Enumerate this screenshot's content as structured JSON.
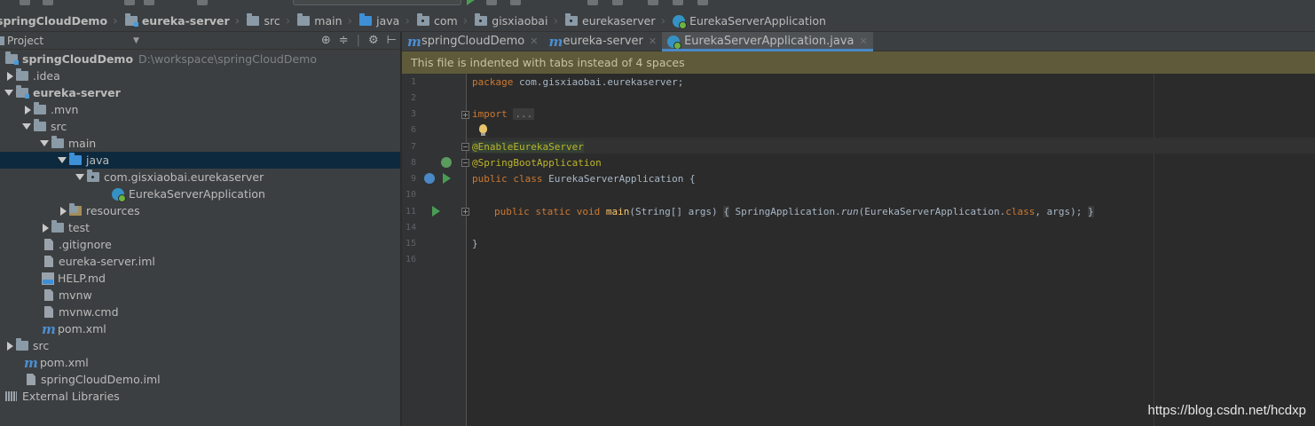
{
  "breadcrumbs": [
    {
      "label": "springCloudDemo",
      "icon": "module-folder-icon"
    },
    {
      "label": "eureka-server",
      "icon": "module-folder-icon"
    },
    {
      "label": "src",
      "icon": "folder-icon"
    },
    {
      "label": "main",
      "icon": "folder-icon"
    },
    {
      "label": "java",
      "icon": "source-folder-icon"
    },
    {
      "label": "com",
      "icon": "package-icon"
    },
    {
      "label": "gisxiaobai",
      "icon": "package-icon"
    },
    {
      "label": "eurekaserver",
      "icon": "package-icon"
    },
    {
      "label": "EurekaServerApplication",
      "icon": "spring-boot-class-icon"
    }
  ],
  "project_panel": {
    "title": "Project",
    "tree": [
      {
        "label": "springCloudDemo",
        "extra": "D:\\workspace\\springCloudDemo",
        "icon": "module-folder-icon",
        "expanded": true,
        "bold": true
      },
      {
        "label": ".idea",
        "icon": "folder-icon",
        "expanded": false
      },
      {
        "label": "eureka-server",
        "icon": "module-folder-icon",
        "expanded": true,
        "bold": true
      },
      {
        "label": ".mvn",
        "icon": "folder-icon",
        "expanded": false
      },
      {
        "label": "src",
        "icon": "folder-icon",
        "expanded": true
      },
      {
        "label": "main",
        "icon": "folder-icon",
        "expanded": true
      },
      {
        "label": "java",
        "icon": "source-folder-icon",
        "expanded": true,
        "selected": true
      },
      {
        "label": "com.gisxiaobai.eurekaserver",
        "icon": "package-icon",
        "expanded": true
      },
      {
        "label": "EurekaServerApplication",
        "icon": "spring-boot-class-icon"
      },
      {
        "label": "resources",
        "icon": "resources-folder-icon",
        "expanded": false
      },
      {
        "label": "test",
        "icon": "folder-icon",
        "expanded": false
      },
      {
        "label": ".gitignore",
        "icon": "file-icon"
      },
      {
        "label": "eureka-server.iml",
        "icon": "file-icon"
      },
      {
        "label": "HELP.md",
        "icon": "markdown-file-icon"
      },
      {
        "label": "mvnw",
        "icon": "file-icon"
      },
      {
        "label": "mvnw.cmd",
        "icon": "file-icon"
      },
      {
        "label": "pom.xml",
        "icon": "maven-icon"
      },
      {
        "label": "src",
        "icon": "folder-icon",
        "expanded": false
      },
      {
        "label": "pom.xml",
        "icon": "maven-icon"
      },
      {
        "label": "springCloudDemo.iml",
        "icon": "file-icon"
      },
      {
        "label": "External Libraries",
        "icon": "library-icon"
      }
    ]
  },
  "editor": {
    "tabs": [
      {
        "label": "springCloudDemo",
        "icon": "maven-icon",
        "active": false
      },
      {
        "label": "eureka-server",
        "icon": "maven-icon",
        "active": false
      },
      {
        "label": "EurekaServerApplication.java",
        "icon": "spring-boot-class-icon",
        "active": true
      }
    ],
    "banner": "This file is indented with tabs instead of 4 spaces",
    "line_numbers": [
      "1",
      "2",
      "3",
      "6",
      "7",
      "8",
      "9",
      "10",
      "11",
      "14",
      "15",
      "16"
    ],
    "code": {
      "package_kw": "package",
      "package_name": " com.gisxiaobai.eurekaserver;",
      "import_kw": "import",
      "import_folded": "...",
      "annotation_enable": "@EnableEurekaServer",
      "annotation_boot": "@SpringBootApplication",
      "class_kw": "public class",
      "class_name": " EurekaServerApplication {",
      "main_mods": "public static void",
      "main_name": "main",
      "main_params": "(String[] args)",
      "body_open": "{",
      "body_call": " SpringApplication.",
      "body_run": "run",
      "body_args": "(EurekaServerApplication.",
      "body_class_kw": "class",
      "body_tail": ", args);",
      "body_close": "}",
      "closing_brace": "}"
    }
  },
  "watermark": "https://blog.csdn.net/hcdxp",
  "colors": {
    "background": "#2b2b2b",
    "panel": "#3c3f41",
    "selection": "#0d293e",
    "keyword": "#cc7832",
    "annotation": "#bbb529",
    "method": "#ffc66d",
    "banner": "#5f5b3a",
    "tab_underline": "#4a88c7"
  }
}
